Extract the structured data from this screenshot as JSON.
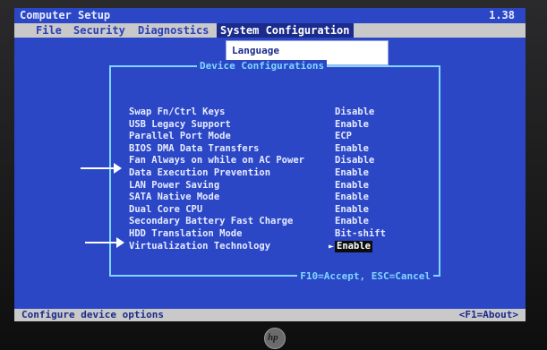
{
  "title": "Computer Setup",
  "version": "1.38",
  "menu": [
    "File",
    "Security",
    "Diagnostics",
    "System Configuration"
  ],
  "active_menu_index": 3,
  "background_item": "Language",
  "dialog": {
    "title": "Device Configurations",
    "footer": "F10=Accept, ESC=Cancel",
    "items": [
      {
        "label": "Swap Fn/Ctrl Keys",
        "value": "Disable"
      },
      {
        "label": "USB Legacy Support",
        "value": "Enable"
      },
      {
        "label": "Parallel Port Mode",
        "value": "ECP"
      },
      {
        "label": "BIOS DMA Data Transfers",
        "value": "Enable"
      },
      {
        "label": "Fan Always on while on AC Power",
        "value": "Disable"
      },
      {
        "label": "Data Execution Prevention",
        "value": "Enable"
      },
      {
        "label": "LAN Power Saving",
        "value": "Enable"
      },
      {
        "label": "SATA Native Mode",
        "value": "Enable"
      },
      {
        "label": "Dual Core CPU",
        "value": "Enable"
      },
      {
        "label": "Secondary Battery Fast Charge",
        "value": "Enable"
      },
      {
        "label": "HDD Translation Mode",
        "value": "Bit-shift"
      },
      {
        "label": "Virtualization Technology",
        "value": "Enable"
      }
    ]
  },
  "status": {
    "left": "Configure device options",
    "right": "<F1=About>"
  },
  "colors": {
    "screen_blue": "#2b47c6",
    "dialog_border": "#7fd7ff",
    "menu_gray": "#c9c9c9"
  }
}
